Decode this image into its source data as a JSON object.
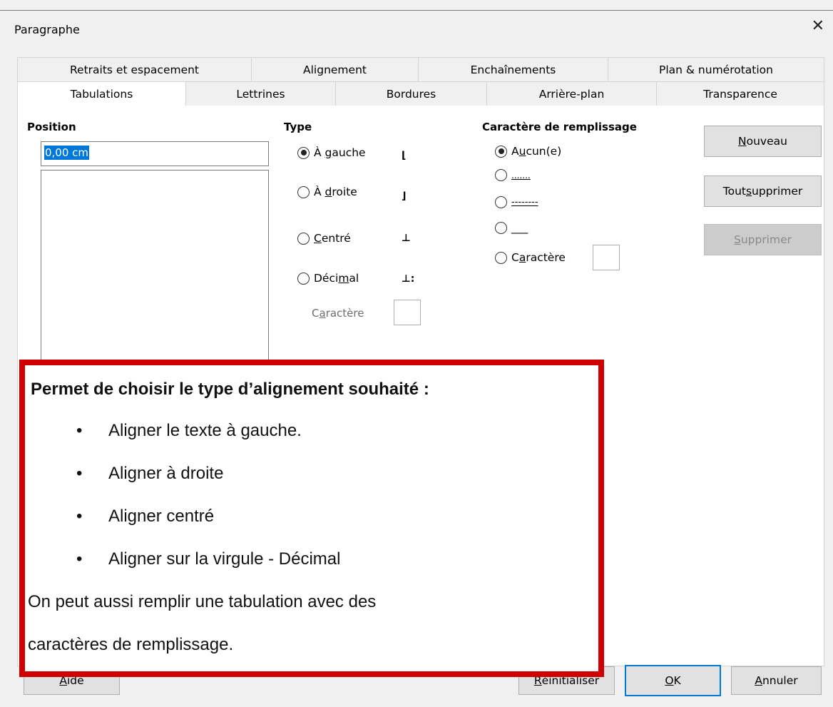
{
  "dialog": {
    "title": "Paragraphe",
    "close_glyph": "✕"
  },
  "tabs_row1": [
    "Retraits et espacement",
    "Alignement",
    "Enchaînements",
    "Plan & numérotation"
  ],
  "tabs_row2": [
    "Tabulations",
    "Lettrines",
    "Bordures",
    "Arrière-plan",
    "Transparence"
  ],
  "active_tab": "Tabulations",
  "position": {
    "label": "Position",
    "value": "0,00 cm"
  },
  "type": {
    "label": "Type",
    "options": [
      {
        "pre": "À ",
        "key": "g",
        "post": "auche",
        "icon": "⌊",
        "selected": true
      },
      {
        "pre": "À ",
        "key": "d",
        "post": "roite",
        "icon": "⌋",
        "selected": false
      },
      {
        "pre": "",
        "key": "C",
        "post": "entré",
        "icon": "⊥",
        "selected": false
      },
      {
        "pre": "Déci",
        "key": "m",
        "post": "al",
        "icon": "⊥:",
        "selected": false
      }
    ],
    "char_label_pre": "C",
    "char_label_key": "a",
    "char_label_post": "ractère"
  },
  "fill": {
    "label": "Caractère de remplissage",
    "options": [
      {
        "pre": "A",
        "key": "u",
        "post": "cun(e)",
        "selected": true
      },
      {
        "pre": "",
        "key": ".......",
        "post": "",
        "selected": false
      },
      {
        "pre": "",
        "key": "--------",
        "post": "",
        "selected": false
      },
      {
        "pre": "",
        "key": "___",
        "post": "",
        "selected": false
      },
      {
        "pre": "C",
        "key": "a",
        "post": "ractère",
        "selected": false
      }
    ]
  },
  "buttons": {
    "new": {
      "pre": "",
      "key": "N",
      "post": "ouveau"
    },
    "clear_all": {
      "pre": "Tout ",
      "key": "s",
      "post": "upprimer"
    },
    "delete": {
      "pre": "",
      "key": "S",
      "post": "upprimer"
    },
    "help": {
      "pre": "",
      "key": "A",
      "post": "ide"
    },
    "reset": {
      "pre": "",
      "key": "R",
      "post": "éinitialiser"
    },
    "ok": {
      "pre": "",
      "key": "O",
      "post": "K"
    },
    "cancel": {
      "pre": "",
      "key": "A",
      "post": "nnuler"
    }
  },
  "callout": {
    "heading": "Permet de choisir le type d’alignement souhaité :",
    "bullets": [
      "Aligner le texte à gauche.",
      "Aligner à droite",
      "Aligner centré",
      "Aligner sur la virgule - Décimal"
    ],
    "bullet_glyph": "•",
    "para_line1": "On peut aussi remplir une tabulation avec des",
    "para_line2": "caractères de remplissage."
  },
  "colors": {
    "accent": "#0078d7",
    "callout_border": "#d00000"
  }
}
